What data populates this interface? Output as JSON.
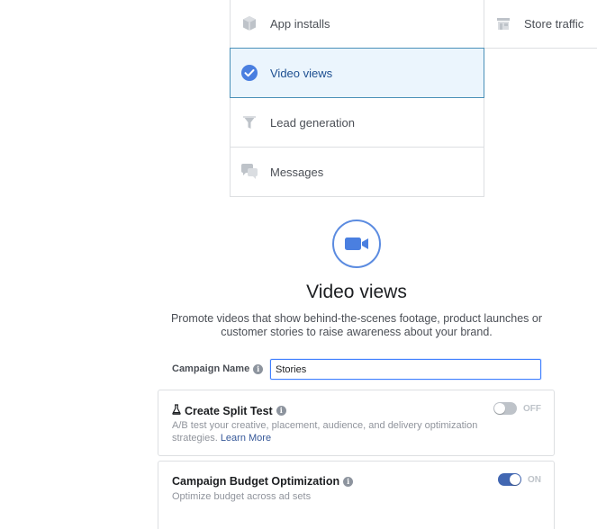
{
  "objectives_col1": [
    {
      "label": "App installs",
      "icon": "box-icon",
      "selected": false
    },
    {
      "label": "Video views",
      "icon": "checkmark-circle-icon",
      "selected": true
    },
    {
      "label": "Lead generation",
      "icon": "funnel-icon",
      "selected": false
    },
    {
      "label": "Messages",
      "icon": "chat-bubbles-icon",
      "selected": false
    }
  ],
  "objectives_col2": [
    {
      "label": "Store traffic",
      "icon": "storefront-icon",
      "selected": false
    }
  ],
  "hero": {
    "icon": "video-camera-icon",
    "title": "Video views",
    "description": "Promote videos that show behind-the-scenes footage, product launches or customer stories to raise awareness about your brand."
  },
  "campaign_name": {
    "label": "Campaign Name",
    "value": "Stories"
  },
  "split_test": {
    "title": "Create Split Test",
    "description": "A/B test your creative, placement, audience, and delivery optimization strategies.",
    "link": "Learn More",
    "toggle_label": "OFF",
    "enabled": false
  },
  "budget_opt": {
    "title": "Campaign Budget Optimization",
    "description": "Optimize budget across ad sets",
    "toggle_label": "ON",
    "enabled": true
  },
  "colors": {
    "accent": "#4267b2",
    "selected_bg": "#ebf5fd",
    "selected_border": "#4a90b8",
    "hero_ring": "#5b8be0"
  }
}
